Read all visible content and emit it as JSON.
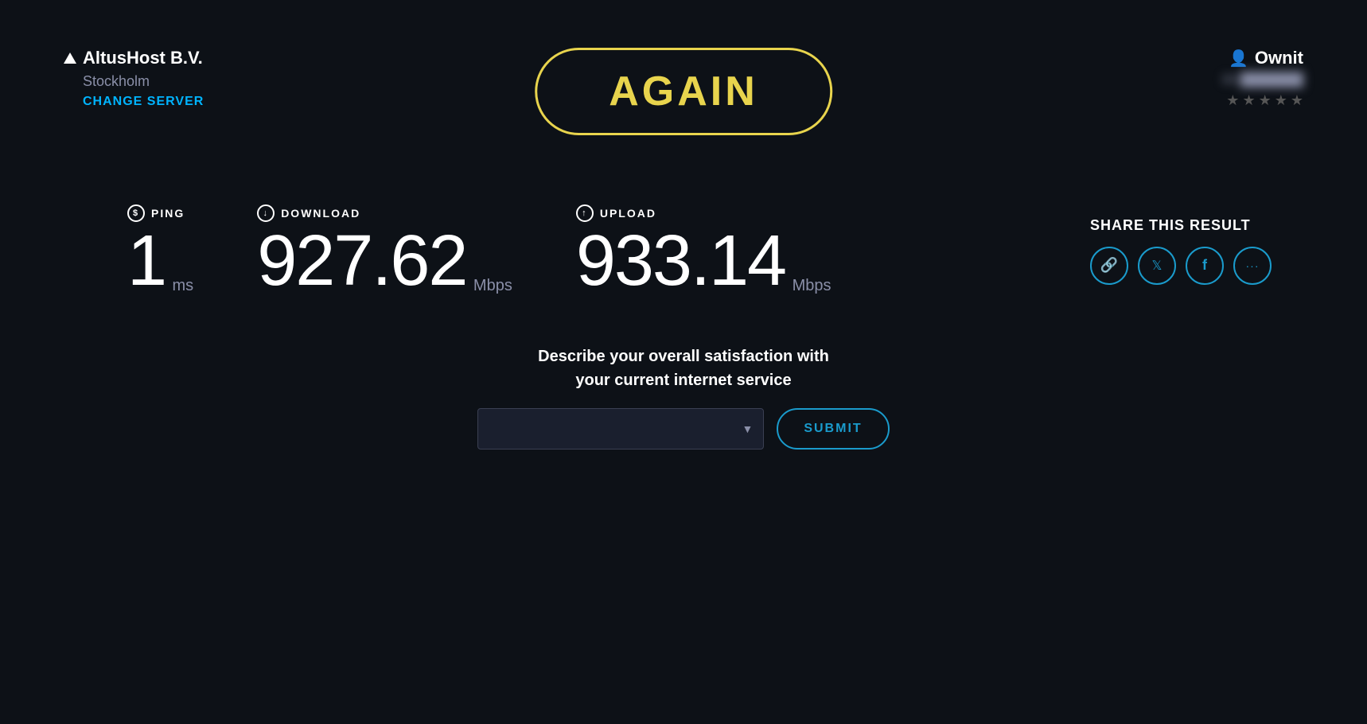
{
  "server": {
    "name": "AltusHost B.V.",
    "location": "Stockholm",
    "change_label": "CHANGE SERVER"
  },
  "again_button": {
    "label": "AGAIN"
  },
  "user": {
    "name": "Ownit",
    "ip": "84.■■■■■■",
    "stars": [
      false,
      false,
      false,
      false,
      false
    ]
  },
  "stats": {
    "ping": {
      "label": "PING",
      "value": "1",
      "unit": "ms",
      "icon": "S"
    },
    "download": {
      "label": "DOWNLOAD",
      "value": "927.62",
      "unit": "Mbps",
      "icon": "↓"
    },
    "upload": {
      "label": "UPLOAD",
      "value": "933.14",
      "unit": "Mbps",
      "icon": "↑"
    }
  },
  "share": {
    "title": "SHARE THIS RESULT",
    "icons": [
      "🔗",
      "🐦",
      "f",
      "···"
    ]
  },
  "satisfaction": {
    "text": "Describe your overall satisfaction with\nyour current internet service",
    "dropdown_placeholder": "",
    "submit_label": "SUBMIT"
  }
}
